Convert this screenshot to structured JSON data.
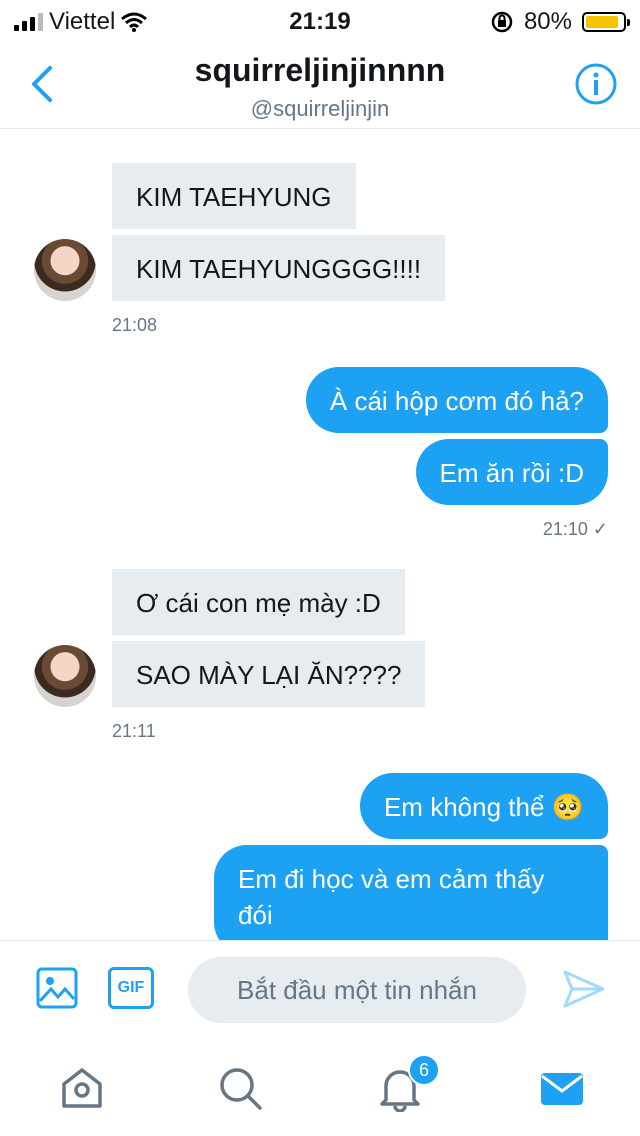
{
  "status_bar": {
    "carrier": "Viettel",
    "time": "21:19",
    "battery": "80%",
    "battery_level": 0.8
  },
  "header": {
    "title": "squirreljinjinnnn",
    "handle": "@squirreljinjin"
  },
  "messages": [
    {
      "side": "in",
      "text": "KIM TAEHYUNG"
    },
    {
      "side": "in",
      "text": "KIM TAEHYUNGGGG!!!!"
    },
    {
      "side": "in",
      "text": "21:08"
    },
    {
      "side": "out",
      "text": "À cái hộp cơm đó hả?"
    },
    {
      "side": "out",
      "text": "Em ăn rồi :D"
    },
    {
      "side": "out",
      "text": "21:10 ✓"
    },
    {
      "side": "in",
      "text": "Ơ cái con mẹ mày :D"
    },
    {
      "side": "in",
      "text": "SAO MÀY LẠI ĂN????"
    },
    {
      "side": "in",
      "text": "21:11"
    },
    {
      "side": "out",
      "text": "Em không thể 🥺"
    },
    {
      "side": "out",
      "text": "Em đi học và em cảm thấy"
    },
    {
      "side": "out",
      "text": "đói"
    }
  ],
  "composer": {
    "gif_label": "GIF",
    "placeholder": "Bắt đầu một tin nhắn"
  },
  "tabbar": {
    "notifications_badge": "6",
    "accent": "#1da1f2"
  }
}
